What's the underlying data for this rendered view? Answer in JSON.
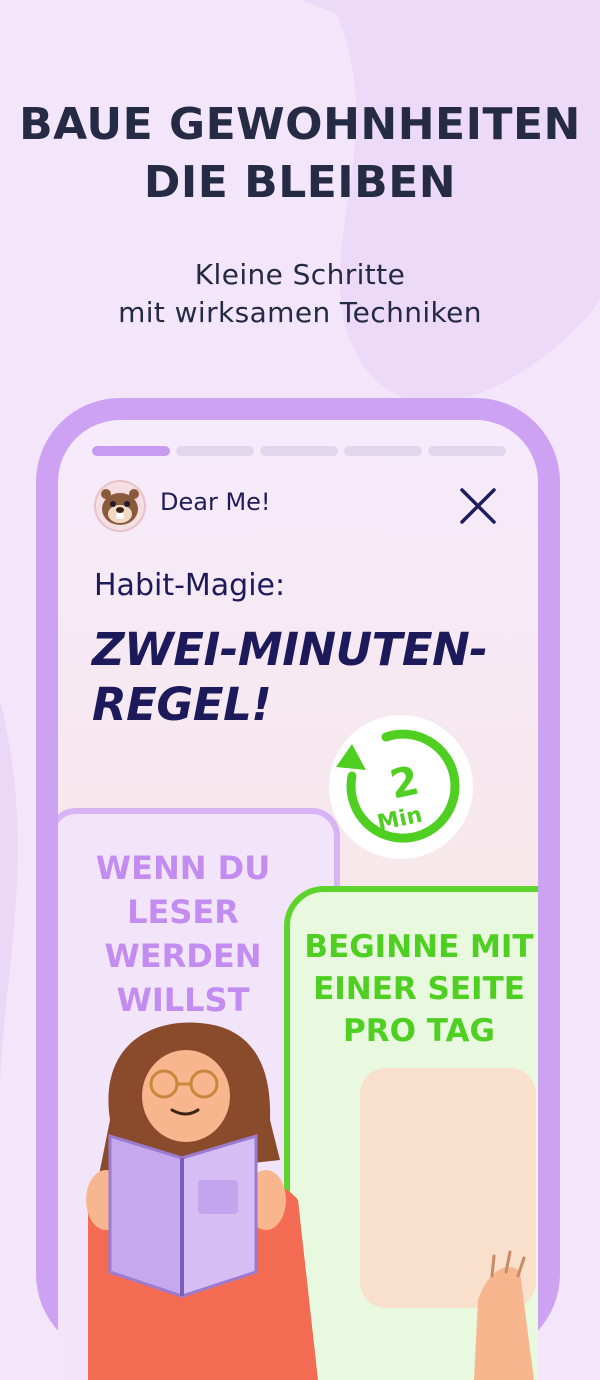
{
  "hero": {
    "title_line1": "BAUE GEWOHNHEITEN",
    "title_line2": "DIE BLEIBEN",
    "subtitle_line1": "Kleine Schritte",
    "subtitle_line2": "mit wirksamen Techniken"
  },
  "phone": {
    "progress": {
      "segments": 5,
      "active_segment": 1
    },
    "header": {
      "app_name": "Dear Me!",
      "avatar_icon": "beaver-mascot-icon",
      "close_icon": "close-icon"
    },
    "story": {
      "pre_title": "Habit-Magie:",
      "title_line1": "ZWEI-MINUTEN-",
      "title_line2": "REGEL!",
      "timer_value": "2",
      "timer_unit": "Min",
      "left_card_lines": [
        "WENN DU",
        "LESER",
        "WERDEN",
        "WILLST"
      ],
      "right_card_lines": [
        "BEGINNE MIT",
        "EINER SEITE",
        "PRO TAG"
      ]
    }
  },
  "colors": {
    "background": "#f3e6fb",
    "phone_frame": "#cea2f3",
    "dark_text": "#252a45",
    "title_text": "#1d1a5c",
    "purple_accent": "#c38cf0",
    "green_accent": "#4fcf22"
  }
}
